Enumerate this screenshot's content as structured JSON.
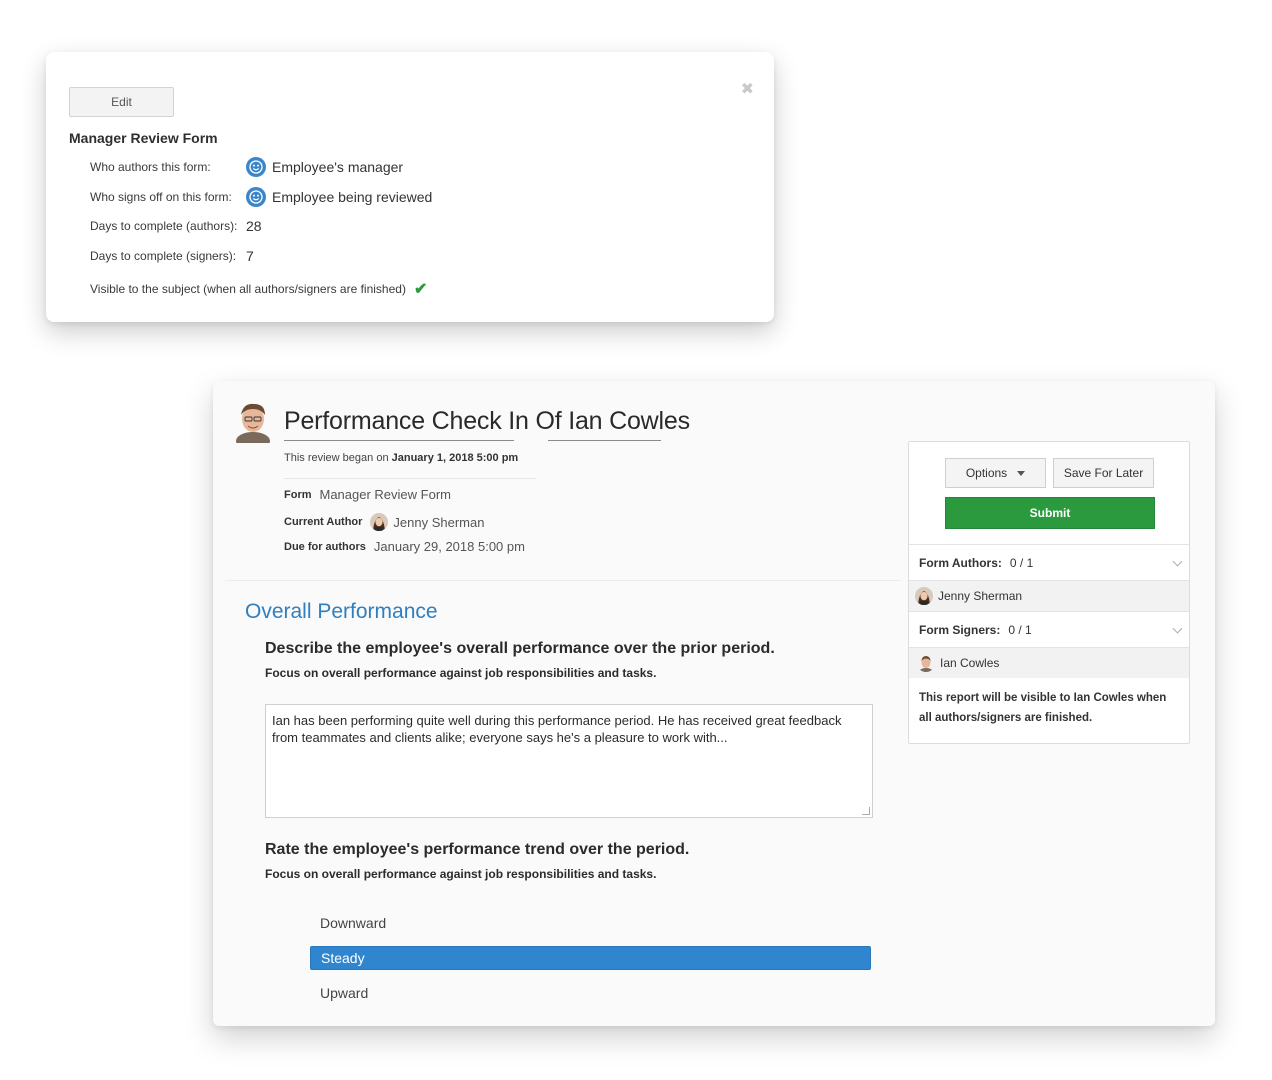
{
  "settings_card": {
    "edit_label": "Edit",
    "close_symbol": "✖",
    "title": "Manager Review Form",
    "rows": [
      {
        "label": "Who authors this form:",
        "value": "Employee's manager",
        "icon": "face-icon"
      },
      {
        "label": "Who signs off on this form:",
        "value": "Employee being reviewed",
        "icon": "face-icon"
      },
      {
        "label": "Days to complete (authors):",
        "value": "28"
      },
      {
        "label": "Days to complete (signers):",
        "value": "7"
      }
    ],
    "visible_label": "Visible to the subject (when all authors/signers are finished)",
    "visible_check": "✔"
  },
  "review": {
    "title": "Performance Check In Of Ian Cowles",
    "began_prefix": "This review began on ",
    "began_date": "January 1, 2018 5:00 pm",
    "form_label": "Form",
    "form_value": "Manager Review Form",
    "author_label": "Current Author",
    "author_value": "Jenny Sherman",
    "due_label": "Due for authors",
    "due_value": "January 29, 2018 5:00 pm",
    "section_title": "Overall Performance",
    "q1_title": "Describe the employee's overall performance over the prior period.",
    "q1_sub": "Focus on overall performance against job responsibilities and tasks.",
    "q1_answer": "Ian has been performing quite well during this performance period. He has received great feedback from teammates and clients alike; everyone says he's a pleasure to work with...",
    "q2_title": "Rate the employee's performance trend over the period.",
    "q2_sub": "Focus on overall performance against job responsibilities and tasks.",
    "options": [
      "Downward",
      "Steady",
      "Upward"
    ],
    "selected_option": "Steady"
  },
  "sidebar": {
    "options_label": "Options",
    "save_label": "Save For Later",
    "submit_label": "Submit",
    "authors_label": "Form Authors:",
    "authors_count": "0 / 1",
    "author_name": "Jenny Sherman",
    "signers_label": "Form Signers:",
    "signers_count": "0 / 1",
    "signer_name": "Ian Cowles",
    "note": "This report will be visible to Ian Cowles when all authors/signers are finished."
  },
  "colors": {
    "accent_blue": "#2f86cf",
    "submit_green": "#2b9a3f",
    "check_green": "#2b9a3a"
  }
}
